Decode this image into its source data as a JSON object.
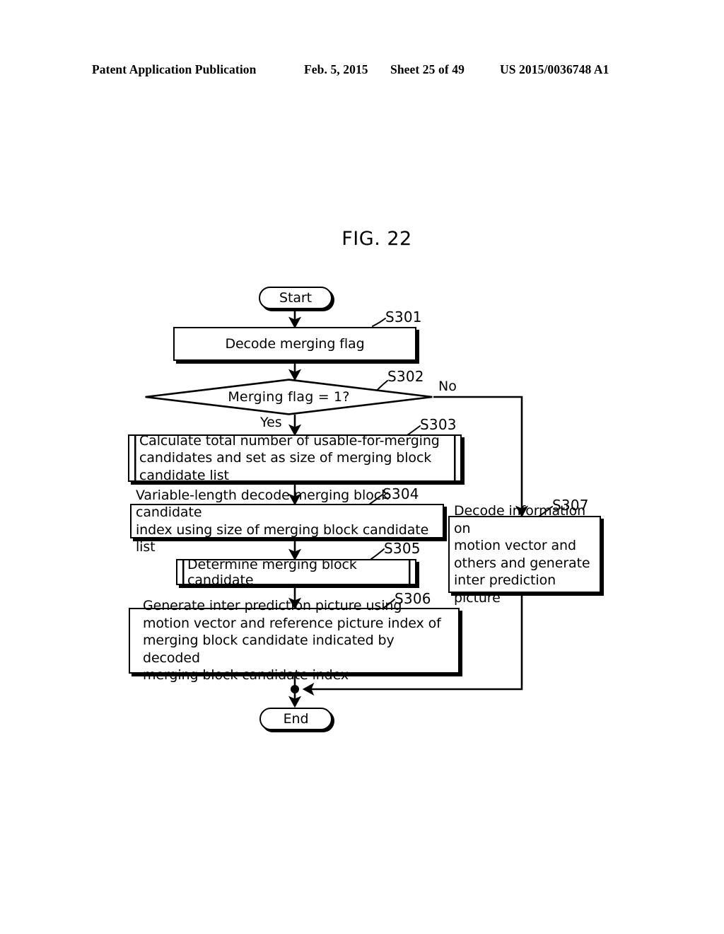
{
  "header": {
    "publication": "Patent Application Publication",
    "date": "Feb. 5, 2015",
    "sheet": "Sheet 25 of 49",
    "number": "US 2015/0036748 A1"
  },
  "figure": {
    "title": "FIG. 22"
  },
  "flowchart": {
    "nodes": {
      "start": {
        "label": "Start",
        "shape": "terminal"
      },
      "s301": {
        "label": "Decode merging flag",
        "shape": "process",
        "tag": "S301"
      },
      "s302": {
        "label": "Merging flag = 1?",
        "shape": "decision",
        "tag": "S302"
      },
      "s303": {
        "label": "Calculate total number of usable-for-merging\ncandidates and set as size of merging block\ncandidate list",
        "shape": "predefined-process",
        "tag": "S303"
      },
      "s304": {
        "label": "Variable-length decode merging block candidate\nindex using size of merging block candidate list",
        "shape": "process",
        "tag": "S304"
      },
      "s305": {
        "label": "Determine merging block candidate",
        "shape": "predefined-process",
        "tag": "S305"
      },
      "s306": {
        "label": "Generate inter prediction picture using\nmotion vector and reference picture index of\nmerging block candidate indicated by decoded\nmerging block candidate index",
        "shape": "process",
        "tag": "S306"
      },
      "s307": {
        "label": "Decode information on\nmotion vector and\nothers and generate\ninter prediction picture",
        "shape": "process",
        "tag": "S307"
      },
      "end": {
        "label": "End",
        "shape": "terminal"
      }
    },
    "branches": {
      "yes": "Yes",
      "no": "No"
    },
    "colors": {
      "stroke": "#000000",
      "fill": "#ffffff"
    }
  }
}
